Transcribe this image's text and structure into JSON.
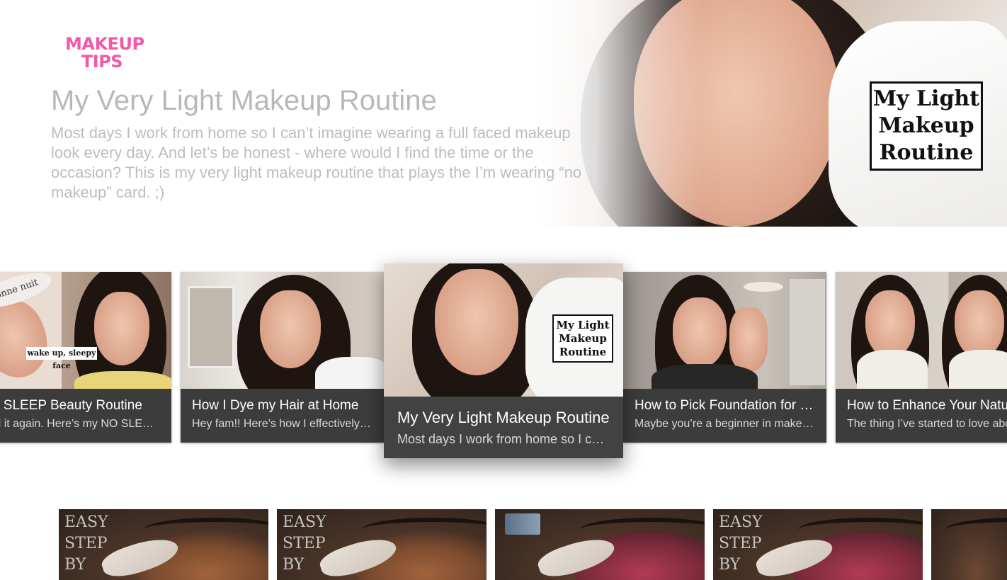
{
  "app": {
    "logo_line1": "MAKEUP",
    "logo_line2": "TIPS",
    "brand_color": "#f05aa8"
  },
  "hero": {
    "title": "My Very Light Makeup Routine",
    "description": "Most days I work from home so I can’t imagine wearing a full faced makeup look every day. And let’s be honest - where would I find the time or the occasion? This is my very light  makeup routine that plays the I’m wearing “no makeup” card. ;)",
    "overlay_text": "My Light\nMakeup\nRoutine"
  },
  "cards": [
    {
      "title": "NO SLEEP Beauty Routine",
      "subtitle": "I did it again. Here’s my NO SLEEP beauty routine",
      "thumb_label": "wake up, sleepy face",
      "headband_text": "bonne nuit",
      "focused": false
    },
    {
      "title": "How I Dye my Hair at Home",
      "subtitle": "Hey fam!! Here’s how I effectively dye my hair at home",
      "focused": false
    },
    {
      "title": "My Very Light Makeup Routine",
      "subtitle": "Most days I work from home so I can’t imagine wearing a full faced makeup look every day.",
      "thumb_overlay": "My Light\nMakeup\nRoutine",
      "focused": true
    },
    {
      "title": "How to Pick Foundation for Beginners",
      "subtitle": "Maybe you’re a beginner in makeup and want to learn",
      "focused": false
    },
    {
      "title": "How to Enhance Your Natural Beauty",
      "subtitle": "The thing I’ve started to love about my face",
      "focused": false
    }
  ],
  "bottom_row": [
    {
      "overlay": "EASY\nSTEP\nBY"
    },
    {
      "overlay": "EASY\nSTEP\nBY"
    },
    {
      "overlay": ""
    },
    {
      "overlay": "EASY\nSTEP\nBY"
    },
    {
      "overlay": ""
    }
  ]
}
